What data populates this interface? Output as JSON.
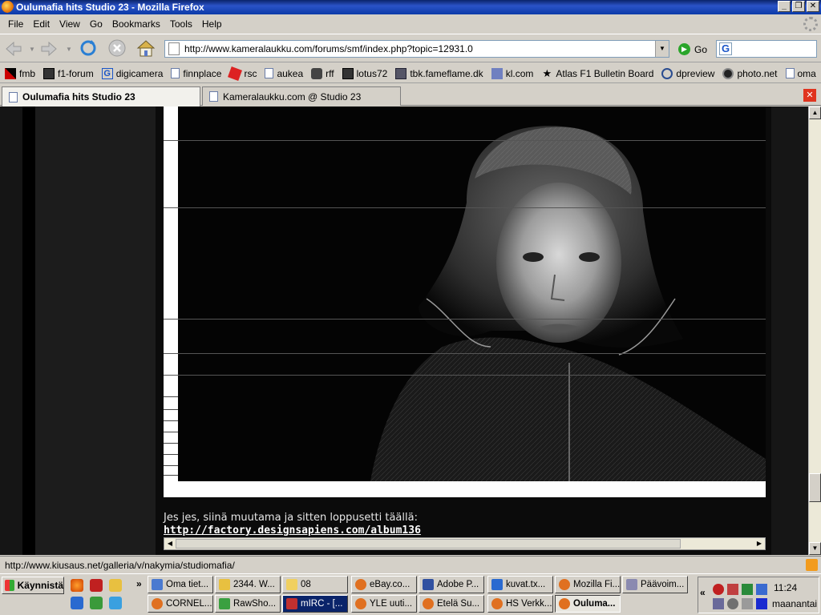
{
  "window": {
    "title": "Oulumafia hits Studio 23 - Mozilla Firefox"
  },
  "menu": [
    "File",
    "Edit",
    "View",
    "Go",
    "Bookmarks",
    "Tools",
    "Help"
  ],
  "nav": {
    "url": "http://www.kameralaukku.com/forums/smf/index.php?topic=12931.0",
    "go_label": "Go"
  },
  "bookmarks": [
    "fmb",
    "f1-forum",
    "digicamera",
    "finnplace",
    "rsc",
    "aukea",
    "rff",
    "lotus72",
    "tbk.fameflame.dk",
    "kl.com",
    "Atlas F1 Bulletin Board",
    "dpreview",
    "photo.net",
    "oma"
  ],
  "tabs": [
    {
      "label": "Oulumafia hits Studio 23",
      "active": true
    },
    {
      "label": "Kameralaukku.com @ Studio 23",
      "active": false
    }
  ],
  "post": {
    "text": "Jes jes, siinä muutama ja sitten loppusetti täällä:",
    "link": "http://factory.designsapiens.com/album136"
  },
  "status": {
    "text": "http://www.kiusaus.net/galleria/v/nakymia/studiomafia/"
  },
  "taskbar": {
    "start_label": "Käynnistä",
    "row1": [
      "Oma tiet...",
      "2344. W...",
      "08",
      "eBay.co...",
      "Adobe P...",
      "kuvat.tx...",
      "Mozilla Fi...",
      "Päävoim..."
    ],
    "row2": [
      "CORNEL...",
      "RawSho...",
      "mIRC - [...",
      "YLE uuti...",
      "Etelä Su...",
      "HS Verkk...",
      "Ouluma..."
    ],
    "clock": "11:24",
    "day": "maanantai"
  }
}
